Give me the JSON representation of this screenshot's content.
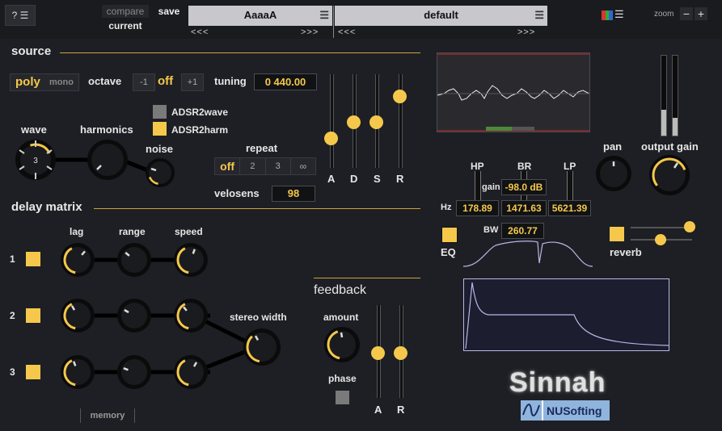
{
  "topbar": {
    "help_label": "?",
    "compare_label": "compare",
    "current_label": "current",
    "save_label": "save",
    "preset_a": "AaaaA",
    "preset_b": "default",
    "prev_arrows": "<<<",
    "next_arrows": ">>>",
    "zoom_label": "zoom",
    "zoom_minus": "−",
    "zoom_plus": "+"
  },
  "source": {
    "title": "source",
    "poly": "poly",
    "mono": "mono",
    "octave_label": "octave",
    "octave_minus": "-1",
    "octave_value": "off",
    "octave_plus": "+1",
    "tuning_label": "tuning",
    "tuning_value": "0 440.00",
    "adsr2wave": "ADSR2wave",
    "adsr2harm": "ADSR2harm",
    "wave_label": "wave",
    "wave_value": "3",
    "harmonics_label": "harmonics",
    "noise_label": "noise",
    "repeat_label": "repeat",
    "repeat_options": [
      "off",
      "2",
      "3",
      "∞"
    ],
    "velosens_label": "velosens",
    "velosens_value": "98",
    "adsr_labels": [
      "A",
      "D",
      "S",
      "R"
    ]
  },
  "delay": {
    "title": "delay matrix",
    "lag": "lag",
    "range": "range",
    "speed": "speed",
    "rows": [
      "1",
      "2",
      "3"
    ],
    "stereo_width": "stereo width",
    "memory": "memory"
  },
  "feedback": {
    "title": "feedback",
    "amount": "amount",
    "phase": "phase",
    "fader_labels": [
      "A",
      "R"
    ]
  },
  "filter": {
    "hp": "HP",
    "br": "BR",
    "lp": "LP",
    "gain_label": "gain",
    "gain_value": "-98.0 dB",
    "hz_label": "Hz",
    "hp_value": "178.89",
    "br_value": "1471.63",
    "lp_value": "5621.39",
    "bw_label": "BW",
    "bw_value": "260.77",
    "eq_label": "EQ"
  },
  "output": {
    "pan": "pan",
    "output_gain": "output gain",
    "reverb": "reverb"
  },
  "brand": {
    "name": "Sinnah",
    "company": "NUSofting"
  },
  "colors": {
    "accent": "#f5c84c",
    "background": "#1e1f24"
  }
}
